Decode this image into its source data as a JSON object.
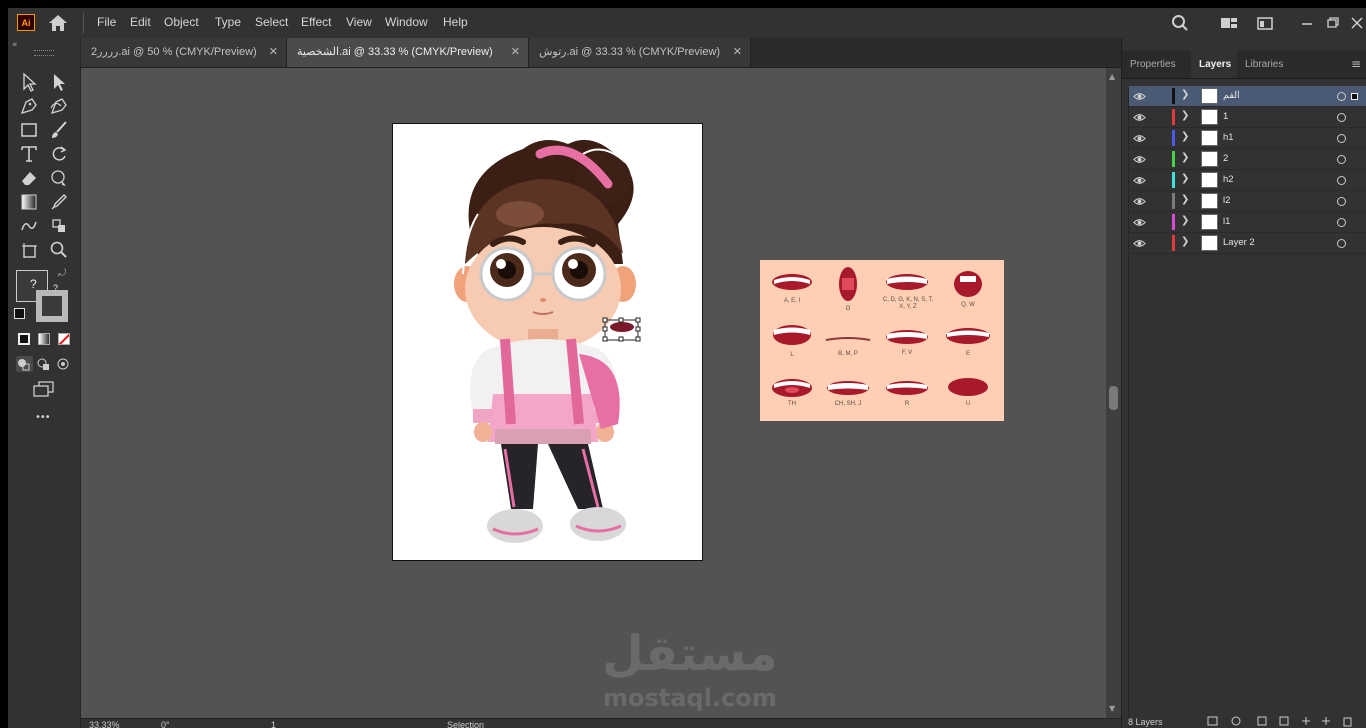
{
  "app": {
    "logo_text": "Ai"
  },
  "menu": {
    "items": [
      "File",
      "Edit",
      "Object",
      "Type",
      "Select",
      "Effect",
      "View",
      "Window",
      "Help"
    ]
  },
  "tabs": [
    {
      "label": "2رررر.ai @ 50 % (CMYK/Preview)",
      "close": "✕",
      "active": false
    },
    {
      "label": "الشخصية.ai @ 33.33 % (CMYK/Preview)",
      "close": "✕",
      "active": true
    },
    {
      "label": "رتوش.ai @ 33.33 % (CMYK/Preview)",
      "close": "✕",
      "active": false
    }
  ],
  "toolbar": {
    "fill_stroke_question": "?",
    "more": "•••"
  },
  "mouth_chart": {
    "labels": [
      "A, E, I",
      "O",
      "C, D, G, K, N, S, T, X, Y, Z",
      "Q, W",
      "L",
      "B, M, P",
      "F, V",
      "E",
      "TH",
      "CH, SH, J",
      "R",
      "U"
    ]
  },
  "watermark": {
    "arabic": "مستقل",
    "latin": "mostaql.com"
  },
  "status": {
    "zoom": "33.33%",
    "rotation": "0°",
    "artboard": "1",
    "tool": "Selection"
  },
  "panel": {
    "tabs": [
      "Properties",
      "Layers",
      "Libraries"
    ],
    "active_tab": "Layers",
    "layers": [
      {
        "name": "الفم",
        "color": "#111111",
        "selected": true
      },
      {
        "name": "1",
        "color": "#e03b3b",
        "selected": false
      },
      {
        "name": "h1",
        "color": "#4a5ae6",
        "selected": false
      },
      {
        "name": "2",
        "color": "#49d14a",
        "selected": false
      },
      {
        "name": "h2",
        "color": "#3ee0e0",
        "selected": false
      },
      {
        "name": "l2",
        "color": "#7b7b7b",
        "selected": false
      },
      {
        "name": "l1",
        "color": "#d64ad6",
        "selected": false
      },
      {
        "name": "Layer 2",
        "color": "#e03b3b",
        "selected": false
      }
    ],
    "footer_count": "8 Layers"
  }
}
